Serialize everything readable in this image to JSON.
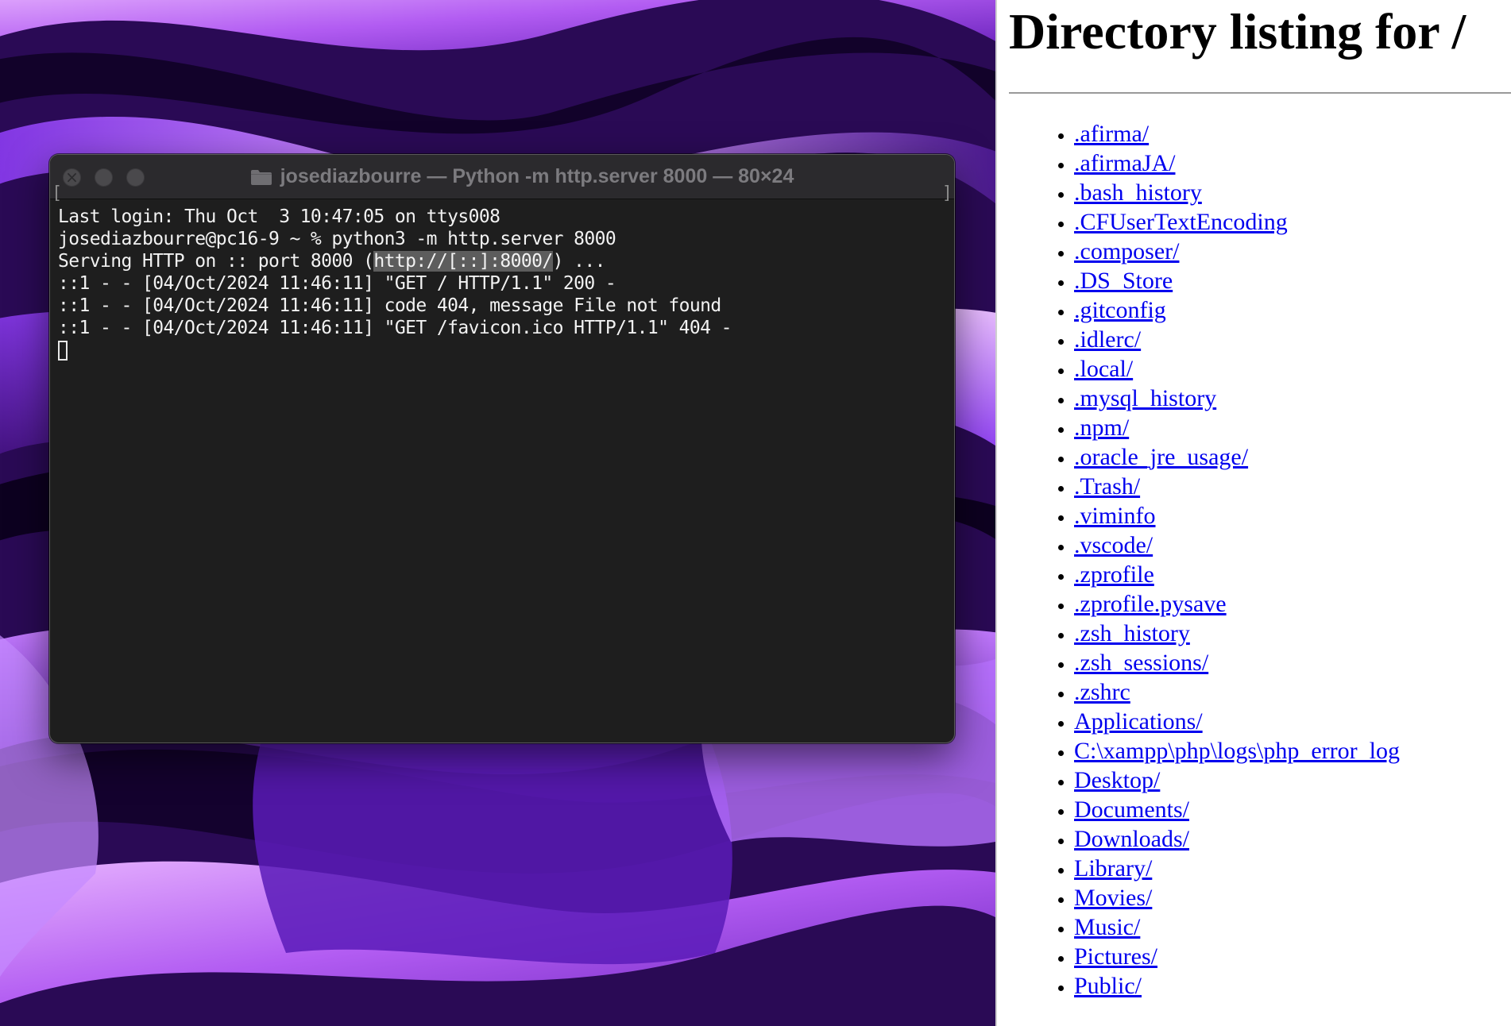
{
  "terminal": {
    "title": "josediazbourre — Python -m http.server 8000 — 80×24",
    "bracket_left": "[",
    "bracket_right": "]",
    "lines": [
      "Last login: Thu Oct  3 10:47:05 on ttys008",
      "josediazbourre@pc16-9 ~ % python3 -m http.server 8000",
      "::1 - - [04/Oct/2024 11:46:11] \"GET / HTTP/1.1\" 200 -",
      "::1 - - [04/Oct/2024 11:46:11] code 404, message File not found",
      "::1 - - [04/Oct/2024 11:46:11] \"GET /favicon.ico HTTP/1.1\" 404 -"
    ],
    "serving": {
      "before": "Serving HTTP on :: port 8000 (",
      "url": "http://[::]:8000/",
      "after": ") ..."
    }
  },
  "browser": {
    "heading": "Directory listing for /",
    "entries": [
      ".afirma/",
      ".afirmaJA/",
      ".bash_history",
      ".CFUserTextEncoding",
      ".composer/",
      ".DS_Store",
      ".gitconfig",
      ".idlerc/",
      ".local/",
      ".mysql_history",
      ".npm/",
      ".oracle_jre_usage/",
      ".Trash/",
      ".viminfo",
      ".vscode/",
      ".zprofile",
      ".zprofile.pysave",
      ".zsh_history",
      ".zsh_sessions/",
      ".zshrc",
      "Applications/",
      "C:\\xampp\\php\\logs\\php_error_log",
      "Desktop/",
      "Documents/",
      "Downloads/",
      "Library/",
      "Movies/",
      "Music/",
      "Pictures/",
      "Public/"
    ]
  },
  "colors": {
    "link": "#0000ee",
    "terminal_bg": "#1e1e1e",
    "wallpaper_accent": "#9b4dff"
  },
  "icons": {
    "traffic_lights": [
      "close-icon",
      "minimize-icon",
      "maximize-icon"
    ],
    "title": "folder-icon"
  }
}
